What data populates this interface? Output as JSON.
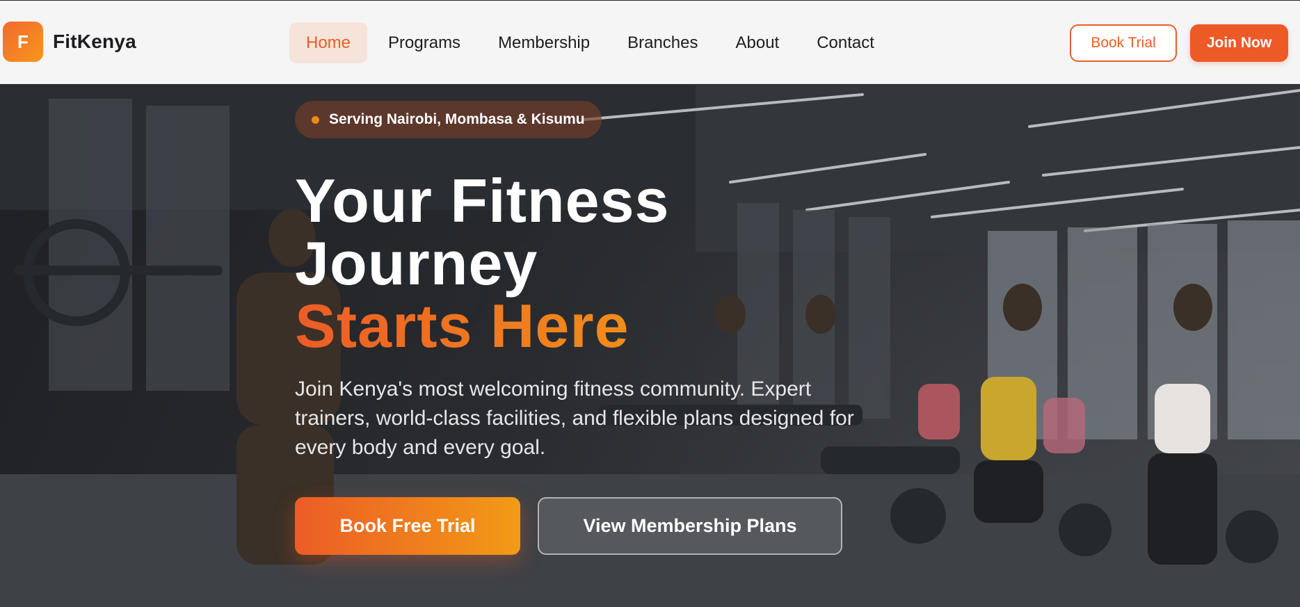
{
  "brand": {
    "logo_letter": "F",
    "name": "FitKenya",
    "accent_color": "#ea5d27",
    "gradient_end": "#f29b15"
  },
  "nav": {
    "items": [
      {
        "label": "Home",
        "active": true
      },
      {
        "label": "Programs",
        "active": false
      },
      {
        "label": "Membership",
        "active": false
      },
      {
        "label": "Branches",
        "active": false
      },
      {
        "label": "About",
        "active": false
      },
      {
        "label": "Contact",
        "active": false
      }
    ]
  },
  "header_actions": {
    "book_trial": "Book Trial",
    "join_now": "Join Now"
  },
  "hero": {
    "badge": "Serving Nairobi, Mombasa & Kisumu",
    "headline_line1": "Your Fitness",
    "headline_line2": "Journey",
    "headline_accent": "Starts Here",
    "description": "Join Kenya's most welcoming fitness community. Expert trainers, world-class facilities, and flexible plans designed for every body and every goal.",
    "primary_cta": "Book Free Trial",
    "secondary_cta": "View Membership Plans",
    "background_image": "gym-group-workout-photo"
  }
}
